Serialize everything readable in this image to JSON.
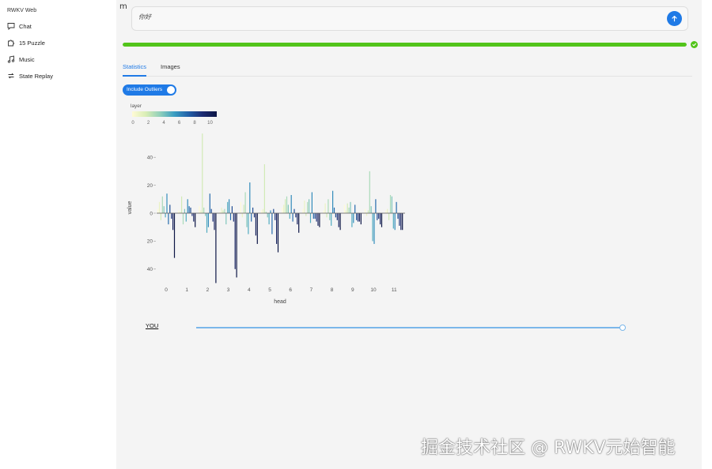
{
  "app": {
    "title": "RWKV Web"
  },
  "sidebar": {
    "items": [
      {
        "label": "Chat",
        "icon": "chat-bubble-icon"
      },
      {
        "label": "15 Puzzle",
        "icon": "puzzle-icon"
      },
      {
        "label": "Music",
        "icon": "music-note-icon"
      },
      {
        "label": "State Replay",
        "icon": "replay-icon"
      }
    ]
  },
  "header": {
    "menu_glyph": "m"
  },
  "prompt": {
    "value": "你好",
    "send_icon": "arrow-up-icon"
  },
  "progress": {
    "percent": 100,
    "color": "#52c41a",
    "status_icon": "check-circle-icon"
  },
  "tabs": [
    {
      "label": "Statistics",
      "active": true
    },
    {
      "label": "Images",
      "active": false
    }
  ],
  "toggle": {
    "label": "Include Outliers",
    "on": true
  },
  "chart_data": {
    "type": "bar",
    "legend_title": "layer",
    "legend_ticks": [
      "0",
      "2",
      "4",
      "6",
      "8",
      "10"
    ],
    "colorscale": [
      "#fffbd6",
      "#d8edb5",
      "#8fcfbb",
      "#3a9dc2",
      "#2260a8",
      "#1d2b72",
      "#0c1545"
    ],
    "xlabel": "head",
    "ylabel": "value",
    "x_ticks": [
      "0",
      "1",
      "2",
      "3",
      "4",
      "5",
      "6",
      "7",
      "8",
      "9",
      "10",
      "11"
    ],
    "y_ticks": [
      "40",
      "20",
      "0",
      "20",
      "40"
    ],
    "ylim": [
      -50,
      57
    ],
    "series": [
      {
        "layer": 0,
        "values": [
          3,
          2,
          5,
          1,
          8,
          2,
          4,
          3,
          2,
          6,
          3,
          2
        ]
      },
      {
        "layer": 1,
        "values": [
          8,
          1,
          2,
          4,
          -3,
          3,
          6,
          9,
          7,
          2,
          -2,
          3
        ]
      },
      {
        "layer": 2,
        "values": [
          -5,
          12,
          57,
          2,
          6,
          35,
          10,
          -2,
          -3,
          7,
          2,
          -5
        ]
      },
      {
        "layer": 3,
        "values": [
          12,
          -8,
          4,
          3,
          15,
          1,
          12,
          8,
          10,
          4,
          30,
          13
        ]
      },
      {
        "layer": 4,
        "values": [
          5,
          3,
          -2,
          -8,
          -10,
          -3,
          6,
          10,
          -5,
          8,
          5,
          12
        ]
      },
      {
        "layer": 5,
        "values": [
          -3,
          -6,
          -14,
          8,
          -15,
          -8,
          -4,
          -7,
          -9,
          -10,
          -20,
          -11
        ]
      },
      {
        "layer": 6,
        "values": [
          14,
          10,
          -10,
          10,
          22,
          2,
          13,
          15,
          16,
          -7,
          -22,
          -12
        ]
      },
      {
        "layer": 7,
        "values": [
          -8,
          5,
          14,
          -5,
          -6,
          -15,
          -6,
          -4,
          4,
          6,
          10,
          8
        ]
      },
      {
        "layer": 8,
        "values": [
          6,
          4,
          3,
          5,
          4,
          3,
          3,
          -4,
          -3,
          -5,
          -5,
          -4
        ]
      },
      {
        "layer": 9,
        "values": [
          -4,
          -2,
          -6,
          -6,
          -3,
          -5,
          -3,
          -6,
          -5,
          -6,
          -4,
          -9
        ]
      },
      {
        "layer": 10,
        "values": [
          -12,
          -6,
          -12,
          -40,
          -16,
          -22,
          -8,
          -9,
          -10,
          -6,
          -8,
          -12
        ]
      },
      {
        "layer": 11,
        "values": [
          -32,
          -10,
          -50,
          -46,
          -22,
          -28,
          -14,
          -10,
          -12,
          -8,
          -10,
          -12
        ]
      }
    ]
  },
  "slider": {
    "label": "YOU",
    "fraction": 1.0
  },
  "watermark": "掘金技术社区 @ RWKV元始智能"
}
